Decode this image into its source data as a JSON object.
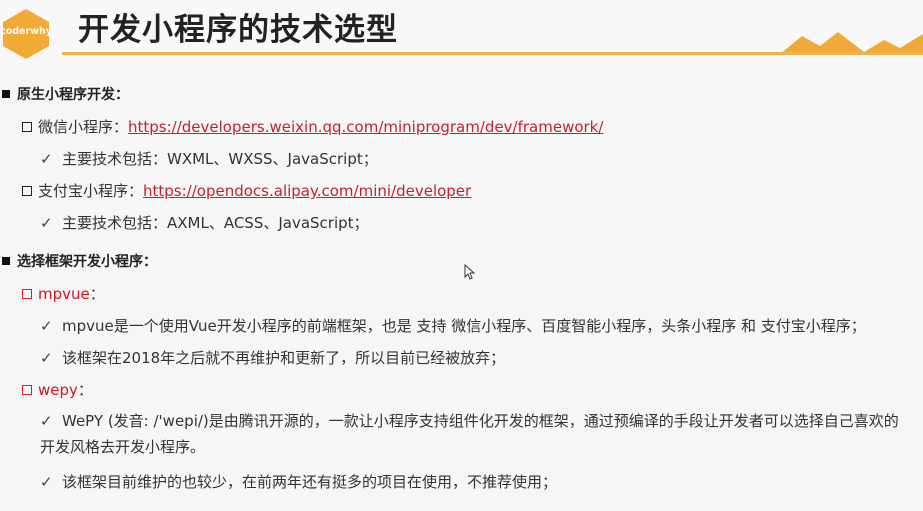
{
  "header": {
    "logo_text": "coderwhy",
    "title": "开发小程序的技术选型"
  },
  "sections": [
    {
      "title": "原生小程序开发：",
      "items": [
        {
          "label": "微信小程序：",
          "link": "https://developers.weixin.qq.com/miniprogram/dev/framework/",
          "points": [
            "主要技术包括：WXML、WXSS、JavaScript；"
          ]
        },
        {
          "label": "支付宝小程序：",
          "link": "https://opendocs.alipay.com/mini/developer",
          "points": [
            "主要技术包括：AXML、ACSS、JavaScript；"
          ]
        }
      ]
    },
    {
      "title": "选择框架开发小程序：",
      "items": [
        {
          "label": "mpvue",
          "suffix": "：",
          "points": [
            "mpvue是一个使用Vue开发小程序的前端框架，也是 支持 微信小程序、百度智能小程序，头条小程序 和 支付宝小程序；",
            "该框架在2018年之后就不再维护和更新了，所以目前已经被放弃；"
          ]
        },
        {
          "label": "wepy",
          "suffix": "：",
          "points": [
            "WePY (发音: /'wepi/)是由腾讯开源的，一款让小程序支持组件化开发的框架，通过预编译的手段让开发者可以选择自己喜欢的开发风格去开发小程序。",
            "该框架目前维护的也较少，在前两年还有挺多的项目在使用，不推荐使用；"
          ]
        }
      ]
    }
  ],
  "colors": {
    "accent": "#f0b24a",
    "link": "#c8202a",
    "highlight": "#d0151e"
  },
  "icons": {
    "check": "✓",
    "cursor": "mouse-pointer-icon"
  }
}
